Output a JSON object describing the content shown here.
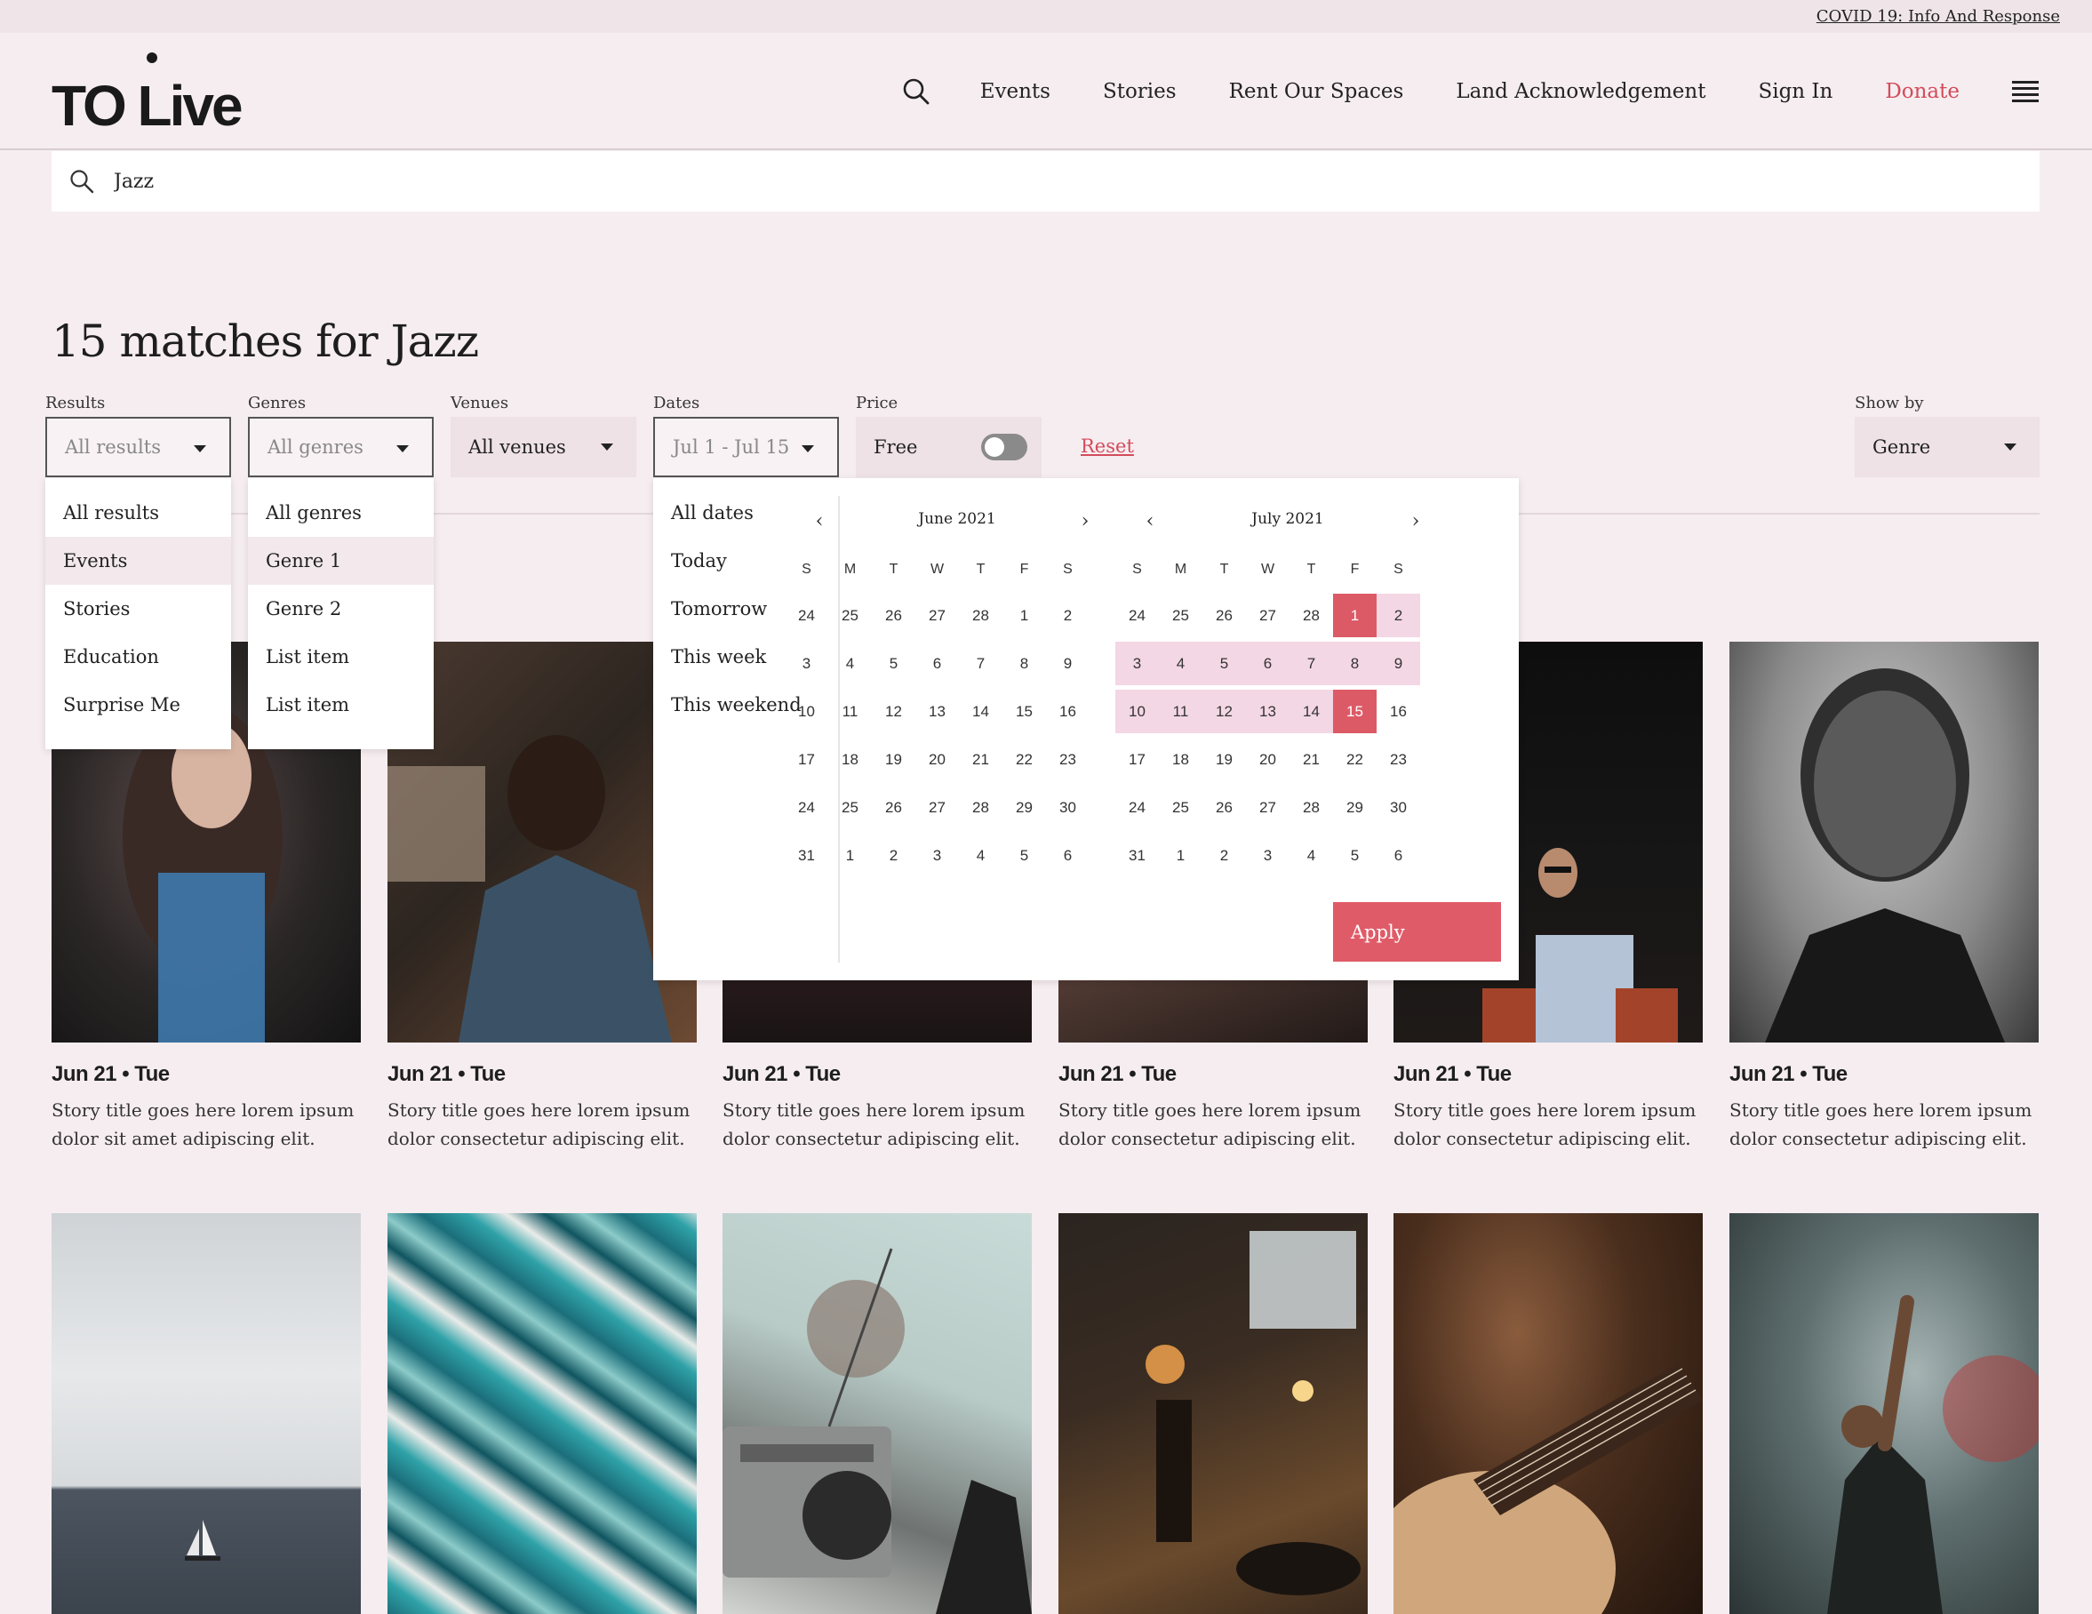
{
  "utility": {
    "covid_link": "COVID 19: Info And Response"
  },
  "header": {
    "logo": "TO Live",
    "nav": [
      "Events",
      "Stories",
      "Rent Our Spaces",
      "Land Acknowledgement",
      "Sign In"
    ],
    "donate": "Donate"
  },
  "search": {
    "value": "Jazz"
  },
  "page_title": "15 matches for Jazz",
  "filters": {
    "results": {
      "label": "Results",
      "value": "All results",
      "options": [
        "All results",
        "Events",
        "Stories",
        "Education",
        "Surprise Me"
      ]
    },
    "genres": {
      "label": "Genres",
      "value": "All genres",
      "options": [
        "All genres",
        "Genre 1",
        "Genre 2",
        "List item",
        "List item"
      ]
    },
    "venues": {
      "label": "Venues",
      "value": "All venues"
    },
    "dates": {
      "label": "Dates",
      "value": "Jul 1 - Jul 15",
      "presets": [
        "All dates",
        "Today",
        "Tomorrow",
        "This week",
        "This weekend"
      ]
    },
    "price": {
      "label": "Price",
      "value": "Free"
    },
    "reset": "Reset",
    "show_by": {
      "label": "Show by",
      "value": "Genre"
    }
  },
  "calendar": {
    "weekdays": [
      "S",
      "M",
      "T",
      "W",
      "T",
      "F",
      "S"
    ],
    "months": [
      {
        "title": "June 2021",
        "days": [
          [
            24,
            25,
            26,
            27,
            28,
            1,
            2
          ],
          [
            3,
            4,
            5,
            6,
            7,
            8,
            9
          ],
          [
            10,
            11,
            12,
            13,
            14,
            15,
            16
          ],
          [
            17,
            18,
            19,
            20,
            21,
            22,
            23
          ],
          [
            24,
            25,
            26,
            27,
            28,
            29,
            30
          ],
          [
            31,
            1,
            2,
            3,
            4,
            5,
            6
          ]
        ]
      },
      {
        "title": "July 2021",
        "days": [
          [
            24,
            25,
            26,
            27,
            28,
            1,
            2
          ],
          [
            3,
            4,
            5,
            6,
            7,
            8,
            9
          ],
          [
            10,
            11,
            12,
            13,
            14,
            15,
            16
          ],
          [
            17,
            18,
            19,
            20,
            21,
            22,
            23
          ],
          [
            24,
            25,
            26,
            27,
            28,
            29,
            30
          ],
          [
            31,
            1,
            2,
            3,
            4,
            5,
            6
          ]
        ],
        "range_start": 1,
        "range_end": 15
      }
    ],
    "apply": "Apply"
  },
  "cards_row1": [
    {
      "date": "Jun 21 • Tue",
      "desc": [
        "Story title goes here lorem ipsum",
        "dolor sit amet adipiscing elit."
      ]
    },
    {
      "date": "Jun 21 • Tue",
      "desc": [
        "Story title goes here lorem ipsum",
        "dolor consectetur adipiscing elit."
      ]
    },
    {
      "date": "Jun 21 • Tue",
      "desc": [
        "Story title goes here lorem ipsum",
        "dolor consectetur adipiscing elit."
      ]
    },
    {
      "date": "Jun 21 • Tue",
      "desc": [
        "Story title goes here lorem ipsum",
        "dolor consectetur adipiscing elit."
      ]
    },
    {
      "date": "Jun 21 • Tue",
      "desc": [
        "Story title goes here lorem ipsum",
        "dolor consectetur adipiscing elit."
      ]
    },
    {
      "date": "Jun 21 • Tue",
      "desc": [
        "Story title goes here lorem ipsum",
        "dolor consectetur adipiscing elit."
      ]
    }
  ],
  "colors": {
    "accent": "#d34b5b",
    "background": "#f6edf0",
    "range": "#f4d7e4",
    "selected": "#dc5a66"
  },
  "icons": [
    "search-icon",
    "hamburger-icon",
    "chevron-down-icon",
    "chevron-left-icon",
    "chevron-right-icon",
    "toggle-switch"
  ]
}
